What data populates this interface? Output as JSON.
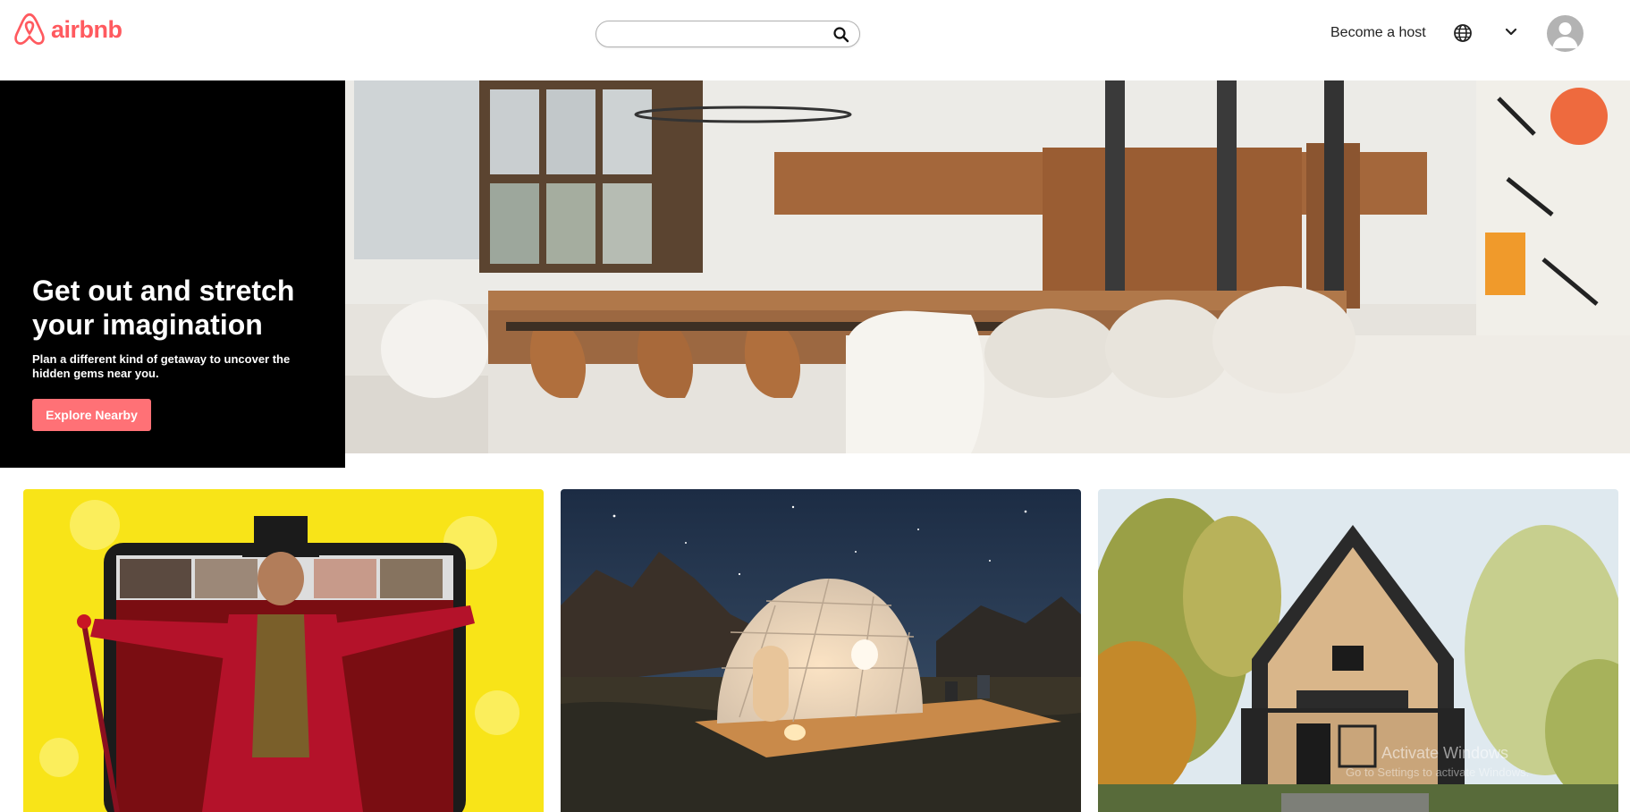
{
  "brand": {
    "name": "airbnb",
    "color": "#ff5a5f"
  },
  "search": {
    "placeholder": "",
    "value": "",
    "icon": "search-icon"
  },
  "nav": {
    "become_host": "Become a host",
    "language_icon": "globe-icon",
    "menu_icon": "chevron-down-icon",
    "profile_icon": "avatar-icon"
  },
  "hero": {
    "title": "Get out and stretch your imagination",
    "subtitle": "Plan a different kind of getaway to uncover the hidden gems near you.",
    "cta": "Explore Nearby",
    "cta_color": "#ff7176"
  },
  "cards": [
    {
      "name": "online-experiences"
    },
    {
      "name": "unique-stays"
    },
    {
      "name": "entire-homes"
    }
  ],
  "os_overlay": {
    "title": "Activate Windows",
    "subtitle": "Go to Settings to activate Windows."
  }
}
